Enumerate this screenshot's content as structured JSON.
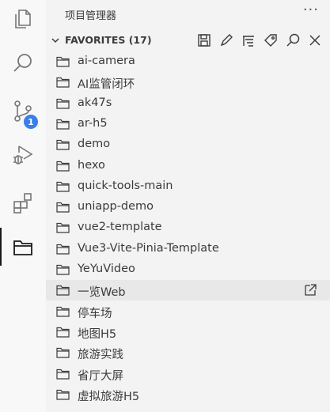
{
  "activity_bar": {
    "items": [
      {
        "name": "explorer-icon"
      },
      {
        "name": "search-icon"
      },
      {
        "name": "source-control-icon",
        "badge": "1"
      },
      {
        "name": "run-debug-icon"
      },
      {
        "name": "extensions-icon"
      },
      {
        "name": "project-manager-icon",
        "active": true
      }
    ]
  },
  "sidebar": {
    "title": "项目管理器",
    "more": "···",
    "section": {
      "title": "FAVORITES (17)",
      "toolbar": [
        "save-icon",
        "edit-icon",
        "filter-icon",
        "tag-icon",
        "search-icon",
        "close-icon"
      ]
    },
    "projects": [
      "ai-camera",
      "AI监管闭环",
      "ak47s",
      "ar-h5",
      "demo",
      "hexo",
      "quick-tools-main",
      "uniapp-demo",
      "vue2-template",
      "Vue3-Vite-Pinia-Template",
      "YeYuVideo",
      "一览Web",
      "停车场",
      "地图H5",
      "旅游实践",
      "省厅大屏",
      "虚拟旅游H5"
    ]
  }
}
